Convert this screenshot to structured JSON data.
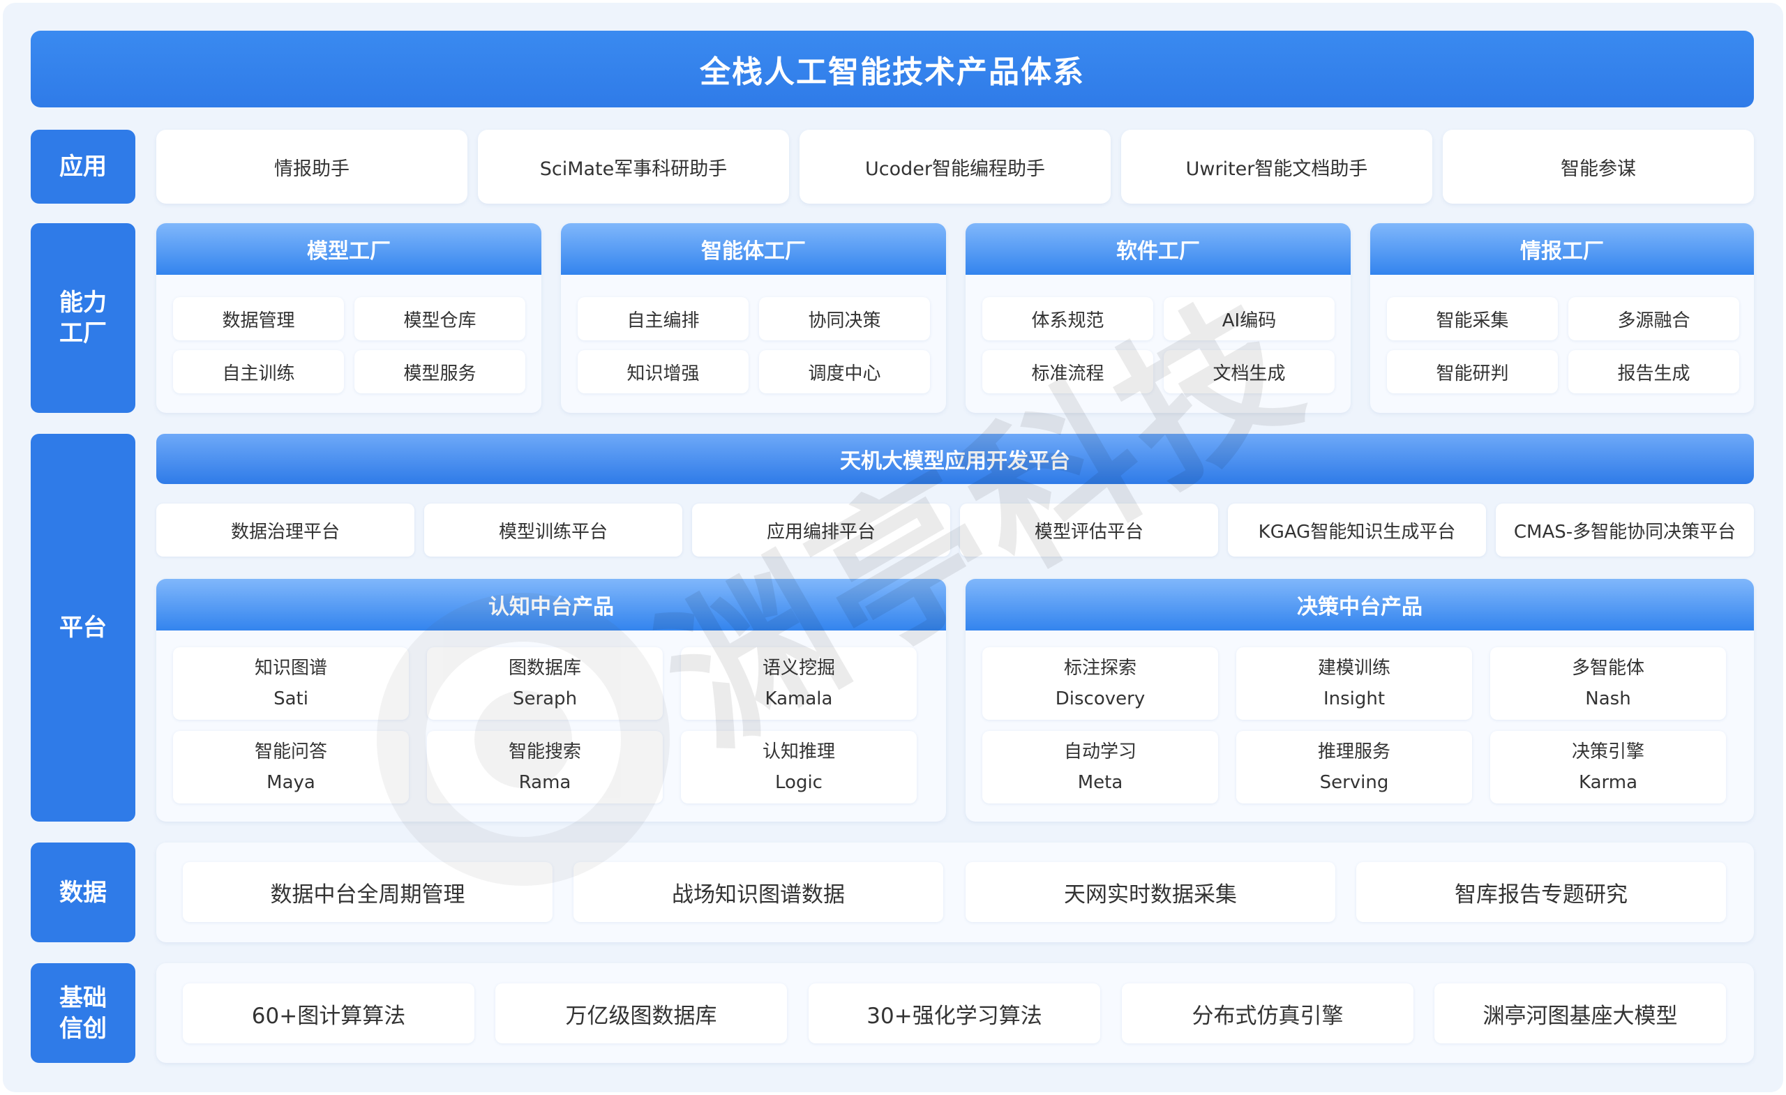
{
  "title": "全栈人工智能技术产品体系",
  "side_labels": {
    "app": "应用",
    "capability": "能力\n工厂",
    "platform": "平台",
    "data": "数据",
    "foundation": "基础\n信创"
  },
  "applications": [
    "情报助手",
    "SciMate军事科研助手",
    "Ucoder智能编程助手",
    "Uwriter智能文档助手",
    "智能参谋"
  ],
  "factories": [
    {
      "name": "模型工厂",
      "items": [
        "数据管理",
        "模型仓库",
        "自主训练",
        "模型服务"
      ]
    },
    {
      "name": "智能体工厂",
      "items": [
        "自主编排",
        "协同决策",
        "知识增强",
        "调度中心"
      ]
    },
    {
      "name": "软件工厂",
      "items": [
        "体系规范",
        "AI编码",
        "标准流程",
        "文档生成"
      ]
    },
    {
      "name": "情报工厂",
      "items": [
        "智能采集",
        "多源融合",
        "智能研判",
        "报告生成"
      ]
    }
  ],
  "platform": {
    "bar_title": "天机大模型应用开发平台",
    "platforms": [
      "数据治理平台",
      "模型训练平台",
      "应用编排平台",
      "模型评估平台",
      "KGAG智能知识生成平台",
      "CMAS-多智能协同决策平台"
    ],
    "cognitive": {
      "title": "认知中台产品",
      "items": [
        {
          "cn": "知识图谱",
          "en": "Sati"
        },
        {
          "cn": "图数据库",
          "en": "Seraph"
        },
        {
          "cn": "语义挖掘",
          "en": "Kamala"
        },
        {
          "cn": "智能问答",
          "en": "Maya"
        },
        {
          "cn": "智能搜索",
          "en": "Rama"
        },
        {
          "cn": "认知推理",
          "en": "Logic"
        }
      ]
    },
    "decision": {
      "title": "决策中台产品",
      "items": [
        {
          "cn": "标注探索",
          "en": "Discovery"
        },
        {
          "cn": "建模训练",
          "en": "Insight"
        },
        {
          "cn": "多智能体",
          "en": "Nash"
        },
        {
          "cn": "自动学习",
          "en": "Meta"
        },
        {
          "cn": "推理服务",
          "en": "Serving"
        },
        {
          "cn": "决策引擎",
          "en": "Karma"
        }
      ]
    }
  },
  "data_items": [
    "数据中台全周期管理",
    "战场知识图谱数据",
    "天网实时数据采集",
    "智库报告专题研究"
  ],
  "foundation_items": [
    "60+图计算算法",
    "万亿级图数据库",
    "30+强化学习算法",
    "分布式仿真引擎",
    "渊亭河图基座大模型"
  ],
  "watermark": "渊亭科技",
  "colors": {
    "primary": "#2f7be8",
    "panel_bg": "#f7faff",
    "page_bg": "#eef4fc"
  }
}
